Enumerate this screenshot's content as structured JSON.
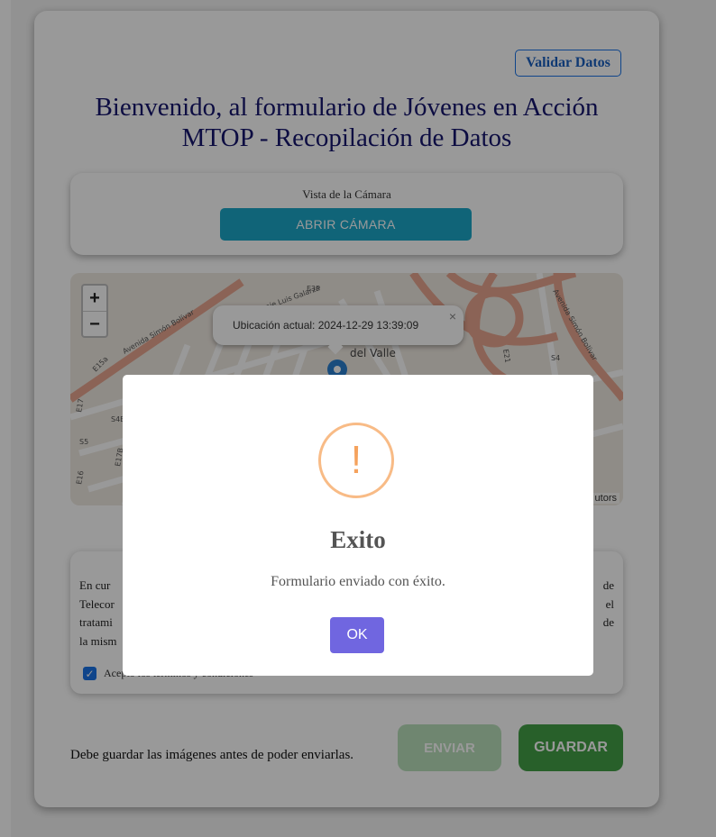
{
  "header": {
    "validate_button": "Validar Datos",
    "title_line1": "Bienvenido, al formulario de Jóvenes en Acción",
    "title_line2": "MTOP - Recopilación de Datos"
  },
  "camera": {
    "label": "Vista de la Cámara",
    "open_button": "ABRIR CÁMARA"
  },
  "map": {
    "zoom_in": "+",
    "zoom_out": "−",
    "popup_text": "Ubicación actual: 2024-12-29 13:39:09",
    "popup_close": "×",
    "attribution": "utors",
    "street_labels": [
      "Avenida Simón Bolívar",
      "Avenida Simón Bolívar",
      "Pasaje Luis Galarza",
      "E3P",
      "E21",
      "S4",
      "E17",
      "E15a",
      "E16",
      "S4B",
      "E17B",
      "S5",
      "del Valle"
    ]
  },
  "terms": {
    "line1_start": "En cur",
    "line1_end": "de",
    "line2_start": "Telecor",
    "line2_end": "el",
    "line3_start": "tratami",
    "line3_end": "de",
    "line4_start": "la mism",
    "checkbox_label": "Acepto los términos y condiciones",
    "checked": true
  },
  "footer": {
    "note": "Debe guardar las imágenes antes de poder enviarlas.",
    "send_button": "ENVIAR",
    "save_button": "GUARDAR"
  },
  "modal": {
    "icon": "warning-icon",
    "icon_glyph": "!",
    "title": "Exito",
    "message": "Formulario enviado con éxito.",
    "ok_button": "OK"
  },
  "colors": {
    "title": "#16166e",
    "camera_button": "#1ba7c9",
    "save_button": "#43a047",
    "ok_button": "#7066e0",
    "warning": "#f8bb86"
  }
}
